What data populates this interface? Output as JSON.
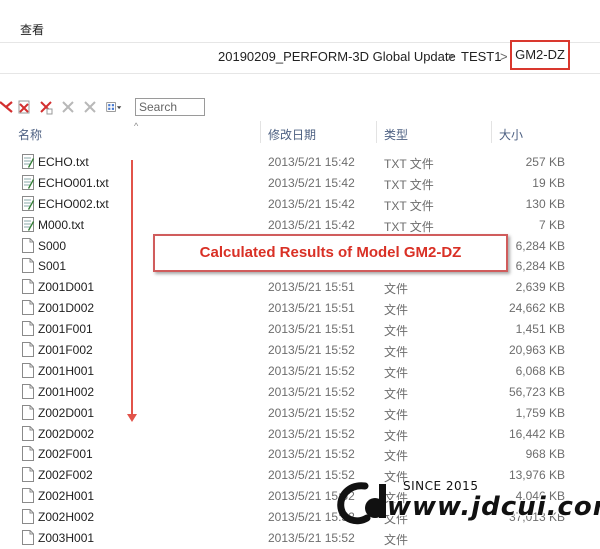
{
  "menu": {
    "view_label": "查看"
  },
  "breadcrumb": {
    "items": [
      "20190209_PERFORM-3D Global Update",
      "TEST1",
      "GM2-DZ"
    ],
    "separator": ">"
  },
  "search": {
    "placeholder": "Search"
  },
  "columns": {
    "name": "名称",
    "date": "修改日期",
    "type": "类型",
    "size": "大小"
  },
  "files": [
    {
      "name": "ECHO.txt",
      "date": "2013/5/21 15:42",
      "type": "TXT 文件",
      "size": "257 KB",
      "icon": "text-file-icon"
    },
    {
      "name": "ECHO001.txt",
      "date": "2013/5/21 15:42",
      "type": "TXT 文件",
      "size": "19 KB",
      "icon": "text-file-icon"
    },
    {
      "name": "ECHO002.txt",
      "date": "2013/5/21 15:42",
      "type": "TXT 文件",
      "size": "130 KB",
      "icon": "text-file-icon"
    },
    {
      "name": "M000.txt",
      "date": "2013/5/21 15:42",
      "type": "TXT 文件",
      "size": "7 KB",
      "icon": "text-file-icon"
    },
    {
      "name": "S000",
      "date": "",
      "type": "",
      "size": "6,284 KB",
      "icon": "blank-file-icon"
    },
    {
      "name": "S001",
      "date": "",
      "type": "",
      "size": "6,284 KB",
      "icon": "blank-file-icon"
    },
    {
      "name": "Z001D001",
      "date": "2013/5/21 15:51",
      "type": "文件",
      "size": "2,639 KB",
      "icon": "blank-file-icon"
    },
    {
      "name": "Z001D002",
      "date": "2013/5/21 15:51",
      "type": "文件",
      "size": "24,662 KB",
      "icon": "blank-file-icon"
    },
    {
      "name": "Z001F001",
      "date": "2013/5/21 15:51",
      "type": "文件",
      "size": "1,451 KB",
      "icon": "blank-file-icon"
    },
    {
      "name": "Z001F002",
      "date": "2013/5/21 15:52",
      "type": "文件",
      "size": "20,963 KB",
      "icon": "blank-file-icon"
    },
    {
      "name": "Z001H001",
      "date": "2013/5/21 15:52",
      "type": "文件",
      "size": "6,068 KB",
      "icon": "blank-file-icon"
    },
    {
      "name": "Z001H002",
      "date": "2013/5/21 15:52",
      "type": "文件",
      "size": "56,723 KB",
      "icon": "blank-file-icon"
    },
    {
      "name": "Z002D001",
      "date": "2013/5/21 15:52",
      "type": "文件",
      "size": "1,759 KB",
      "icon": "blank-file-icon"
    },
    {
      "name": "Z002D002",
      "date": "2013/5/21 15:52",
      "type": "文件",
      "size": "16,442 KB",
      "icon": "blank-file-icon"
    },
    {
      "name": "Z002F001",
      "date": "2013/5/21 15:52",
      "type": "文件",
      "size": "968 KB",
      "icon": "blank-file-icon"
    },
    {
      "name": "Z002F002",
      "date": "2013/5/21 15:52",
      "type": "文件",
      "size": "13,976 KB",
      "icon": "blank-file-icon"
    },
    {
      "name": "Z002H001",
      "date": "2013/5/21 15:52",
      "type": "文件",
      "size": "4,046 KB",
      "icon": "blank-file-icon"
    },
    {
      "name": "Z002H002",
      "date": "2013/5/21 15:52",
      "type": "文件",
      "size": "37,013 KB",
      "icon": "blank-file-icon"
    },
    {
      "name": "Z003H001",
      "date": "2013/5/21 15:52",
      "type": "文件",
      "size": "",
      "icon": "blank-file-icon"
    }
  ],
  "annotation": {
    "callout_text": "Calculated Results of  Model GM2-DZ"
  },
  "watermark": {
    "since": "SINCE 2015",
    "url": "www.jdcui.com"
  },
  "colors": {
    "accent_red": "#d93025",
    "header_text": "#4d6082",
    "muted_text": "#6d6d6d"
  }
}
